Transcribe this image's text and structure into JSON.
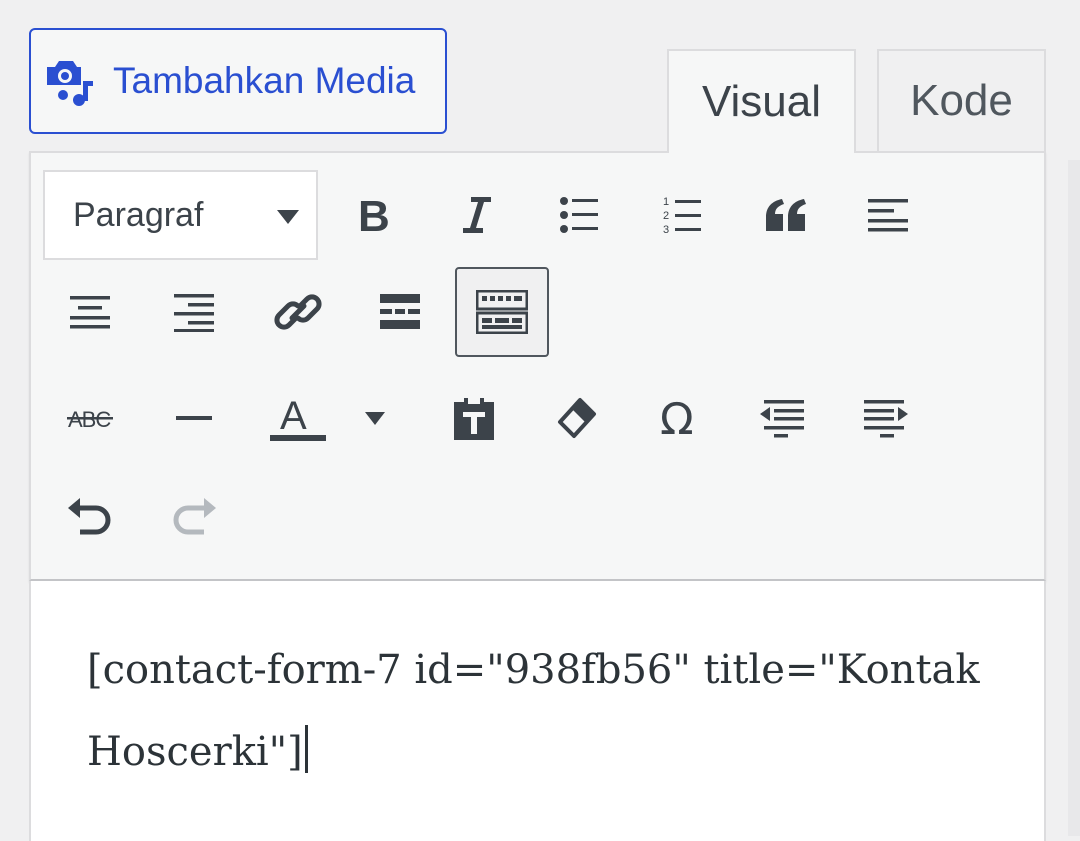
{
  "media_button": {
    "label": "Tambahkan Media",
    "icon": "media-camera-music-icon"
  },
  "tabs": [
    {
      "label": "Visual",
      "active": true
    },
    {
      "label": "Kode",
      "active": false
    }
  ],
  "toolbar": {
    "format_select": {
      "value": "Paragraf"
    },
    "buttons": [
      {
        "name": "bold-icon",
        "active": false
      },
      {
        "name": "italic-icon",
        "active": false
      },
      {
        "name": "bulleted-list-icon",
        "active": false
      },
      {
        "name": "numbered-list-icon",
        "active": false
      },
      {
        "name": "blockquote-icon",
        "active": false
      },
      {
        "name": "align-left-icon",
        "active": false
      },
      {
        "name": "align-center-icon",
        "active": false
      },
      {
        "name": "align-right-icon",
        "active": false
      },
      {
        "name": "link-icon",
        "active": false
      },
      {
        "name": "read-more-icon",
        "active": false
      },
      {
        "name": "toolbar-toggle-icon",
        "active": true
      },
      {
        "name": "strikethrough-icon",
        "active": false
      },
      {
        "name": "horizontal-line-icon",
        "active": false
      },
      {
        "name": "text-color-icon",
        "active": false
      },
      {
        "name": "text-color-dropdown-icon",
        "active": false
      },
      {
        "name": "paste-as-text-icon",
        "active": false
      },
      {
        "name": "clear-formatting-icon",
        "active": false
      },
      {
        "name": "special-character-icon",
        "active": false
      },
      {
        "name": "outdent-icon",
        "active": false
      },
      {
        "name": "indent-icon",
        "active": false
      },
      {
        "name": "undo-icon",
        "active": false
      },
      {
        "name": "redo-icon",
        "active": false,
        "disabled": true
      }
    ]
  },
  "editor": {
    "content": "[contact-form-7 id=\"938fb56\" title=\"Kontak Hoscerki\"]"
  },
  "colors": {
    "accent": "#2a4fd1",
    "icon": "#3c434a",
    "disabled_icon": "#b4b9be",
    "toolbar_bg": "#f6f7f7",
    "page_bg": "#f0f0f1"
  }
}
